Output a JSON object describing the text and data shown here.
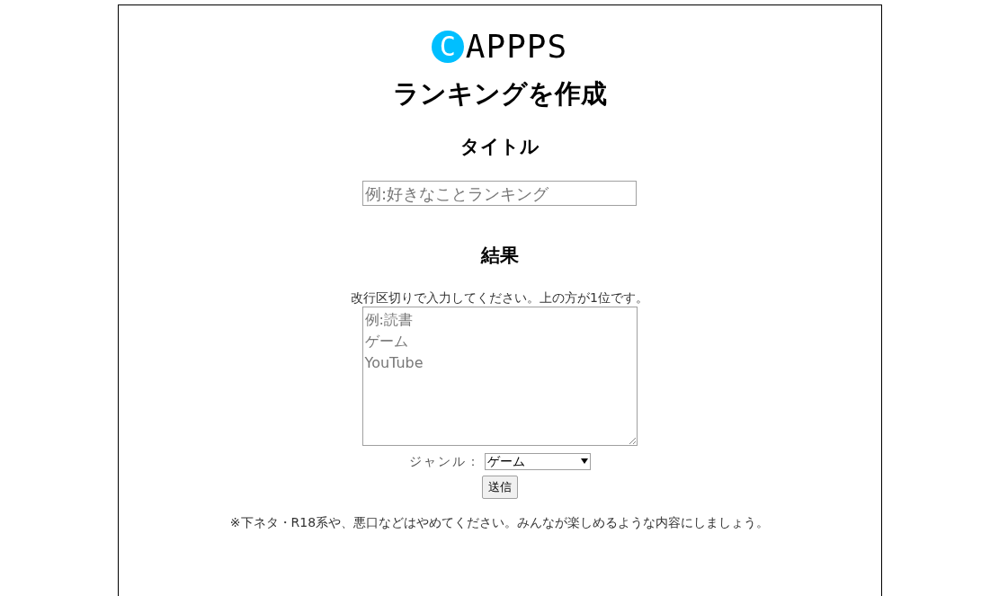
{
  "logo": {
    "mark": "C",
    "text": "APPPS"
  },
  "heading": "ランキングを作成",
  "title_section": {
    "heading": "タイトル",
    "placeholder": "例:好きなことランキング"
  },
  "result_section": {
    "heading": "結果",
    "note": "改行区切りで入力してください。上の方が1位です。",
    "placeholder_lines": [
      "例:読書",
      "ゲーム",
      "YouTube"
    ]
  },
  "genre": {
    "label": "ジャンル：",
    "value": "ゲーム"
  },
  "submit": "送信",
  "warning": "※下ネタ・R18系や、悪口などはやめてください。みんなが楽しめるような内容にしましょう。"
}
